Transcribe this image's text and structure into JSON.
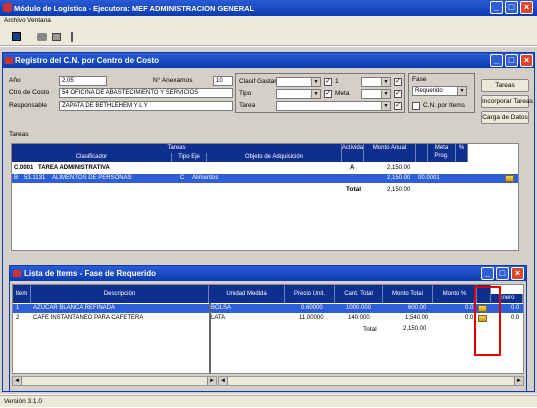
{
  "app": {
    "title": "Módulo de Logística - Ejecutora: MEF ADMINISTRACION GENERAL",
    "menu": [
      "Archivo",
      "Ventana"
    ],
    "status": "Versión 3.1.0"
  },
  "registro": {
    "title": "Registro del C.N. por Centro de Costo",
    "ano_label": "Año",
    "ano_value": "2.05",
    "nro_anexo_label": "N° Anexamos",
    "nro_anexo_value": "10",
    "centro_label": "Ctro de Costo",
    "centro_value": "54 OFICINA DE ABASTECIMIENTO Y SERVICIOS",
    "responsable_label": "Responsable",
    "responsable_value": "ZAPATA DE BETHLEHEM Y L Y",
    "clasif_label": "Clasif Gastar",
    "clasif_value": "1",
    "tipo_label": "Tipo",
    "tipo_value": "Meta",
    "tarea_label": "Tarea",
    "fase_label": "Fase",
    "fase_value": "Requerido",
    "cn_label": "C.N. por Items",
    "buttons": [
      "Tareas",
      "Incorporar Tareas",
      "Carga de Datos"
    ],
    "tareas_label": "Tareas",
    "table": {
      "group_header": "Tareas",
      "headers": [
        "Clasificador",
        "Tipo Eje",
        "Objeto de Adquisición",
        "Actividad",
        "Monto Anual",
        "Meta Prog.",
        "%"
      ],
      "rows": [
        {
          "code": "C.0001",
          "name": "TAREA ADMINISTRATIVA",
          "act": "A",
          "monto": "2,150.00"
        },
        {
          "code": "B",
          "clasif": "53.1131",
          "desc": "ALIMENTOS DE PERSONAS",
          "tipo": "C",
          "obj": "Alimentos",
          "monto": "2,150.00",
          "meta": "00.0001"
        }
      ],
      "total_label": "Total",
      "total_value": "2,150.00"
    }
  },
  "items": {
    "title": "Lista de Items - Fase de Requerido",
    "headers": [
      "Item",
      "Descripción",
      "Unidad Medida",
      "Precio Unit.",
      "Cant. Total",
      "Monto Total",
      "Monto %",
      "Enero"
    ],
    "rows": [
      {
        "n": "1",
        "item": "AZUCAR BLANCA REFINADA",
        "um": "BOLSA",
        "precio": "0.60000",
        "cant": "1000.000",
        "monto": "600.00",
        "pct": "0.0"
      },
      {
        "n": "2",
        "item": "CAFE INSTANTANEO PARA CAFETERA",
        "um": "LATA",
        "precio": "11.00000",
        "cant": "140.000",
        "monto": "1,540.00",
        "pct": "0.0"
      }
    ],
    "total_label": "Total",
    "total_value": "2,150.00"
  }
}
